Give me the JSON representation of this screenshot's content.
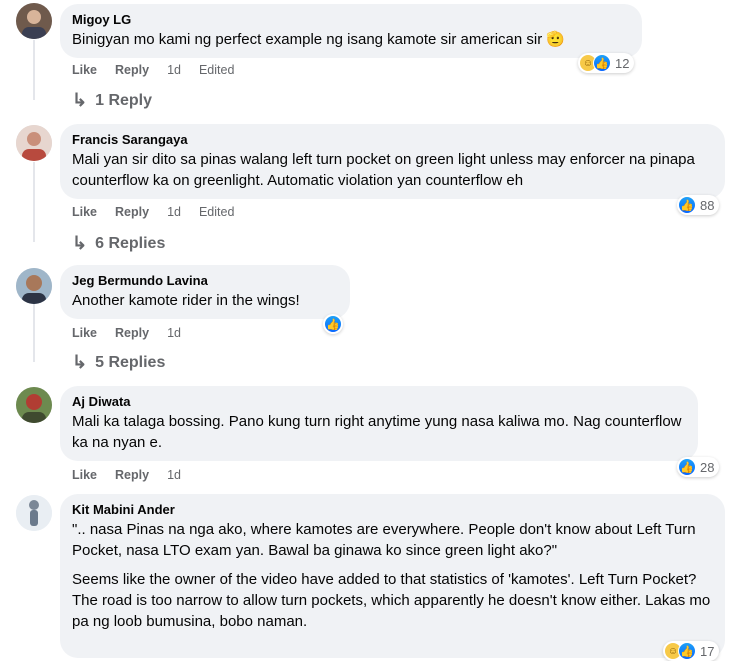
{
  "actions": {
    "like": "Like",
    "reply": "Reply"
  },
  "comments": [
    {
      "author": "Migoy LG",
      "lines": [
        "Binigyan mo kami ng perfect example ng isang kamote sir american sir 🫡"
      ],
      "time": "1d",
      "edited": "Edited",
      "reactions": {
        "icons": [
          "haha-icon",
          "like-icon"
        ],
        "count": "12"
      },
      "replies": "1 Reply"
    },
    {
      "author": "Francis Sarangaya",
      "lines": [
        "Mali yan sir dito sa pinas walang left turn pocket on green light unless may enforcer na pinapa counterflow ka on greenlight. Automatic violation yan counterflow eh"
      ],
      "time": "1d",
      "edited": "Edited",
      "reactions": {
        "icons": [
          "like-icon"
        ],
        "count": "88"
      },
      "replies": "6 Replies"
    },
    {
      "author": "Jeg Bermundo Lavina",
      "lines": [
        "Another kamote rider in the wings!"
      ],
      "time": "1d",
      "reactions": {
        "icons": [
          "like-icon"
        ],
        "count": ""
      },
      "replies": "5 Replies"
    },
    {
      "author": "Aj Diwata",
      "lines": [
        "Mali ka talaga bossing. Pano kung turn right anytime yung nasa kaliwa mo. Nag counterflow ka na nyan e."
      ],
      "time": "1d",
      "reactions": {
        "icons": [
          "like-icon"
        ],
        "count": "28"
      }
    },
    {
      "author": "Kit Mabini Ander",
      "lines": [
        "\".. nasa Pinas na nga ako, where kamotes are everywhere. People don't know about Left Turn Pocket, nasa LTO exam yan. Bawal ba ginawa ko since green light ako?\"",
        "Seems like the owner of the video have added to that statistics of 'kamotes'. Left Turn Pocket? The road is too narrow to allow turn pockets, which apparently he doesn't know either. Lakas mo pa ng loob bumusina, bobo naman."
      ],
      "reactions": {
        "icons": [
          "haha-icon",
          "like-icon"
        ],
        "count": "17"
      }
    }
  ],
  "colors": {
    "bubble": "#f0f2f5",
    "meta": "#65676b",
    "like": "#0866ff"
  }
}
